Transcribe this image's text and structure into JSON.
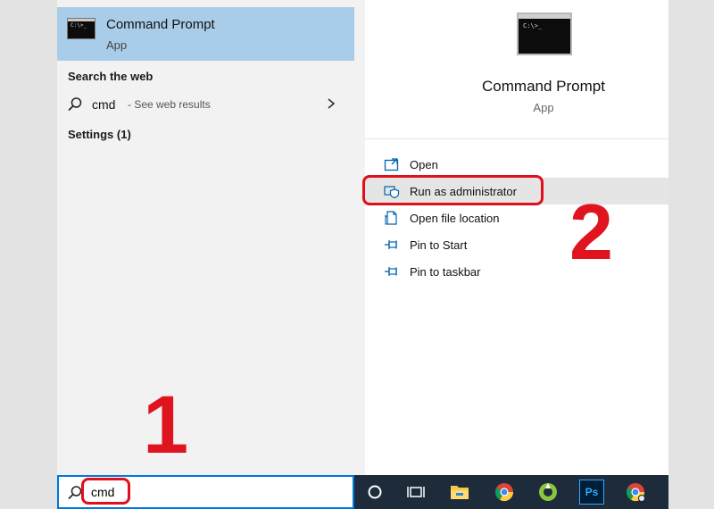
{
  "best_match": {
    "title": "Command Prompt",
    "subtitle": "App",
    "icon": "command-prompt-icon"
  },
  "web_section": {
    "header": "Search the web",
    "term": "cmd",
    "hint": "- See web results",
    "icon": "search-icon"
  },
  "settings_section": {
    "header": "Settings (1)"
  },
  "detail": {
    "title": "Command Prompt",
    "subtitle": "App",
    "actions": [
      {
        "label": "Open",
        "icon": "open-icon"
      },
      {
        "label": "Run as administrator",
        "icon": "shield-icon"
      },
      {
        "label": "Open file location",
        "icon": "file-location-icon"
      },
      {
        "label": "Pin to Start",
        "icon": "pin-icon"
      },
      {
        "label": "Pin to taskbar",
        "icon": "pin-icon"
      }
    ]
  },
  "search_box": {
    "value": "cmd"
  },
  "taskbar": {
    "icons": [
      "cortana-icon",
      "task-view-icon",
      "file-explorer-icon",
      "chrome-icon",
      "greenshot-icon",
      "photoshop-icon",
      "chrome-canary-icon"
    ],
    "photoshop_label": "Ps"
  },
  "annotations": {
    "step1": "1",
    "step2": "2",
    "color": "#e0141e"
  },
  "colors": {
    "selection": "#a9cde9",
    "taskbar": "#1e2b3b",
    "accent": "#0078d7"
  }
}
